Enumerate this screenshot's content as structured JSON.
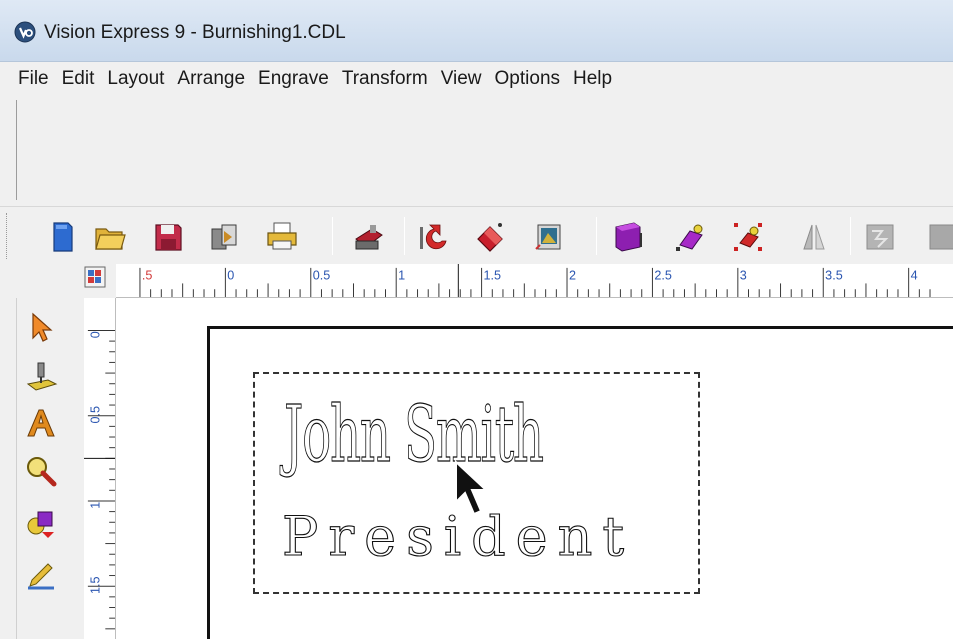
{
  "window": {
    "title": "Vision Express 9 - Burnishing1.CDL"
  },
  "menu": {
    "items": [
      "File",
      "Edit",
      "Layout",
      "Arrange",
      "Engrave",
      "Transform",
      "View",
      "Options",
      "Help"
    ]
  },
  "toolbar": {
    "buttons": [
      {
        "name": "new-document-icon"
      },
      {
        "name": "open-folder-icon"
      },
      {
        "name": "save-icon"
      },
      {
        "name": "import-icon"
      },
      {
        "name": "print-icon"
      },
      {
        "name": "engrave-machine-icon"
      },
      {
        "name": "undo-icon"
      },
      {
        "name": "redo-icon"
      },
      {
        "name": "image-icon"
      },
      {
        "name": "cabinet-icon"
      },
      {
        "name": "node-edit-icon"
      },
      {
        "name": "node-select-icon"
      },
      {
        "name": "mirror-icon"
      },
      {
        "name": "disabled-tool-icon"
      },
      {
        "name": "disabled-tool-2-icon"
      }
    ]
  },
  "hruler": {
    "labels": [
      ".5",
      "0",
      "0.5",
      "1",
      "1.5",
      "2",
      "2.5",
      "3",
      "3.5",
      "4"
    ]
  },
  "vruler": {
    "labels": [
      "0",
      "0.5",
      "1",
      "1.5"
    ]
  },
  "palette": {
    "tools": [
      {
        "name": "pointer-arrow-icon"
      },
      {
        "name": "engrave-tool-icon"
      },
      {
        "name": "text-tool-icon"
      },
      {
        "name": "zoom-icon"
      },
      {
        "name": "shapes-icon"
      },
      {
        "name": "pencil-icon"
      }
    ]
  },
  "canvas": {
    "line1": "John Smith",
    "line2": "President"
  }
}
